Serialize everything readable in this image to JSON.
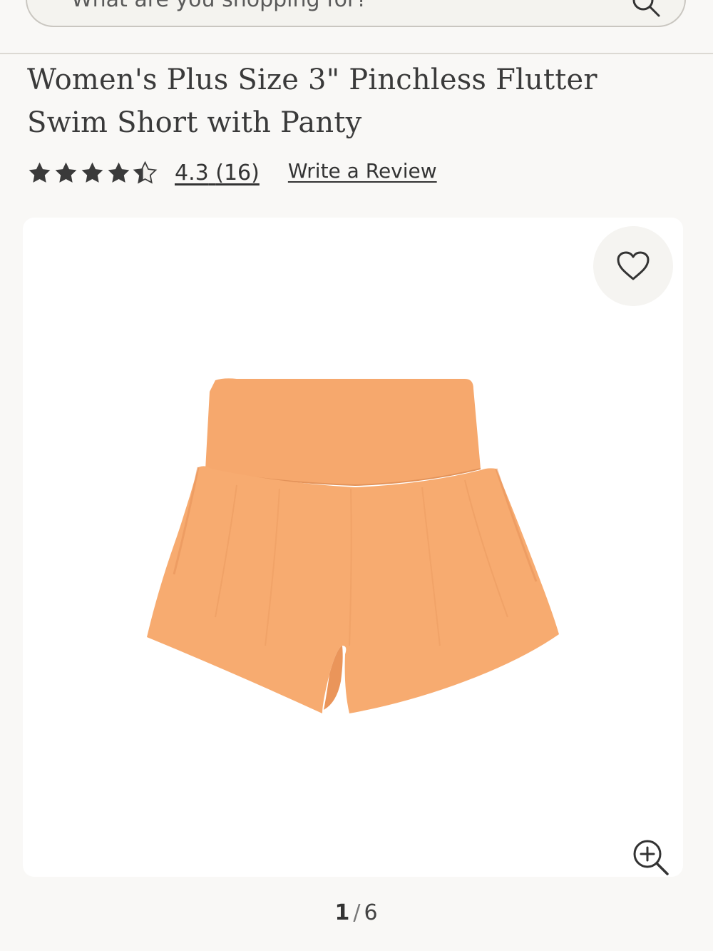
{
  "search": {
    "placeholder": "What are you shopping for?"
  },
  "product": {
    "title": "Women's Plus Size 3\" Pinchless Flutter Swim Short with Panty",
    "rating": 4.3,
    "rating_text": "4.3",
    "review_count_text": "(16)",
    "write_review_label": "Write a Review",
    "image_color": "#f6a86d"
  },
  "gallery": {
    "current": "1",
    "separator": "/",
    "total": "6"
  },
  "icons": {
    "search": "search-icon",
    "favorite": "heart-icon",
    "zoom": "zoom-in-icon",
    "star": "star-icon"
  }
}
